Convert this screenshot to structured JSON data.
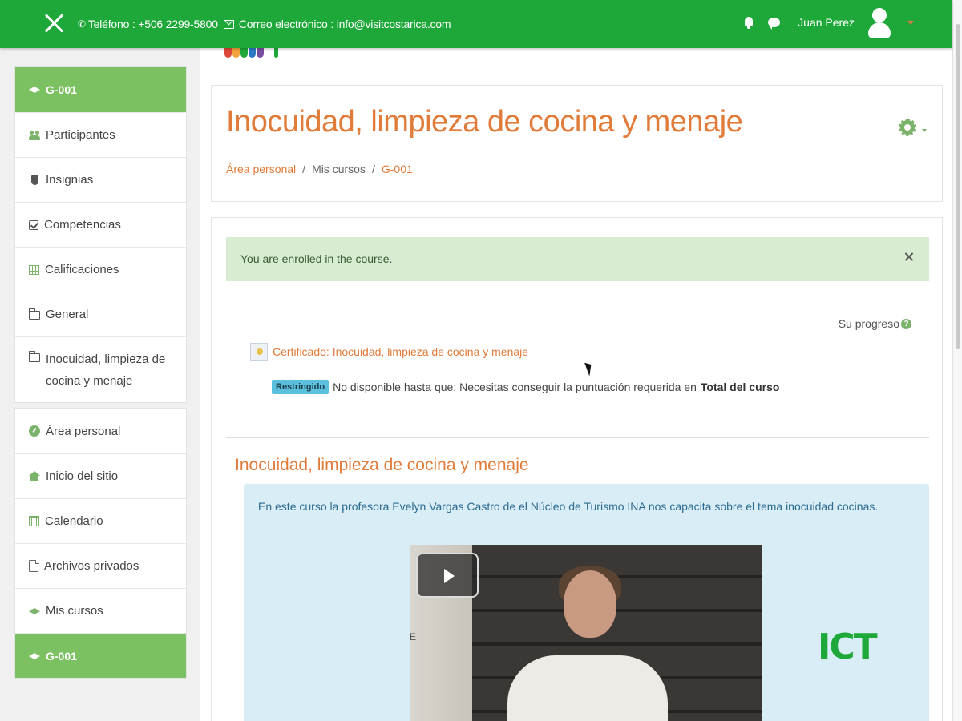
{
  "topbar": {
    "phone": "Teléfono : +506 2299-5800",
    "email": "Correo electrónico : info@visitcostarica.com",
    "user_name": "Juan Perez"
  },
  "sidebar": {
    "course_items": [
      {
        "label": "G-001",
        "icon": "graduation-cap-icon",
        "active": true
      },
      {
        "label": "Participantes",
        "icon": "users-icon"
      },
      {
        "label": "Insignias",
        "icon": "shield-icon"
      },
      {
        "label": "Competencias",
        "icon": "checkbox-icon"
      },
      {
        "label": "Calificaciones",
        "icon": "table-icon"
      },
      {
        "label": "General",
        "icon": "folder-icon"
      },
      {
        "label": "Inocuidad, limpieza de cocina y menaje",
        "icon": "folder-icon"
      }
    ],
    "site_items": [
      {
        "label": "Área personal",
        "icon": "dashboard-icon"
      },
      {
        "label": "Inicio del sitio",
        "icon": "home-icon"
      },
      {
        "label": "Calendario",
        "icon": "calendar-icon"
      },
      {
        "label": "Archivos privados",
        "icon": "file-icon"
      },
      {
        "label": "Mis cursos",
        "icon": "graduation-cap-icon"
      }
    ],
    "footer_item": {
      "label": "G-001",
      "icon": "graduation-cap-icon",
      "active": true
    }
  },
  "header": {
    "course_title": "Inocuidad, limpieza de cocina y menaje",
    "breadcrumb": [
      "Área personal",
      "Mis cursos",
      "G-001"
    ],
    "breadcrumb_sep": "/"
  },
  "content": {
    "alert": "You are enrolled in the course.",
    "progress_label": "Su progreso",
    "help_glyph": "?",
    "certificate_link": "Certificado: Inocuidad, limpieza de cocina y menaje",
    "restricted_badge": "Restringido",
    "restriction_text": "No disponible hasta que: Necesitas conseguir la puntuación requerida en",
    "restriction_bold": "Total del curso",
    "section_title": "Inocuidad, limpieza de cocina y menaje",
    "summary": "En este curso la profesora Evelyn Vargas Castro de el Núcleo de Turismo INA nos capacita sobre el tema inocuidad cocinas.",
    "video_wall_letter": "E",
    "logo_letters": "ICT"
  },
  "colors": {
    "topbar": "#1fa83a",
    "accent": "#e07b39",
    "sidebar_active": "#7bc061",
    "alert_bg": "#d7ecd0",
    "summary_bg": "#d9edf7"
  }
}
